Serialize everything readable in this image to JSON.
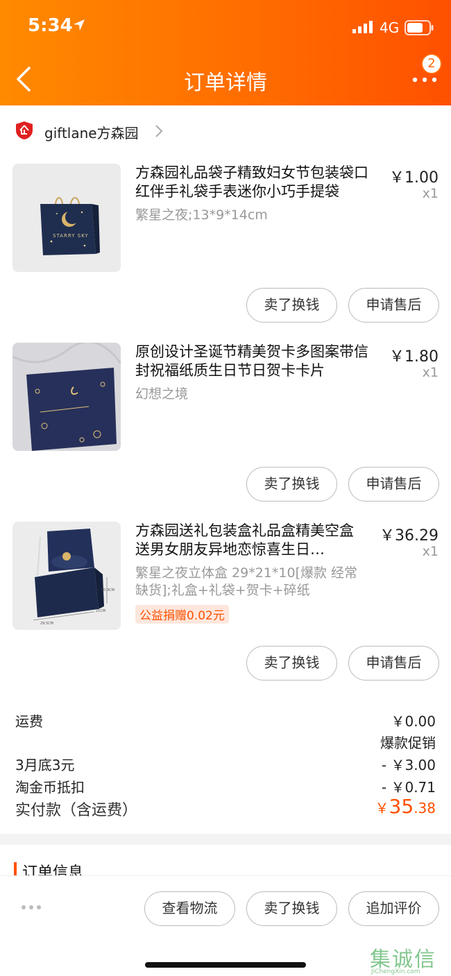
{
  "status_bar": {
    "time": "5:34",
    "network": "4G"
  },
  "header": {
    "title": "订单详情",
    "badge_count": "2"
  },
  "shop": {
    "name": "giftlane方森园"
  },
  "items": [
    {
      "title": "方森园礼品袋子精致妇女节包装袋口红伴手礼袋手表迷你小巧手提袋",
      "spec": "繁星之夜;13*9*14cm",
      "price": "￥1.00",
      "qty": "x1",
      "thumb_text": "STARRY SKY",
      "sell_label": "卖了换钱",
      "after_label": "申请售后"
    },
    {
      "title": "原创设计圣诞节精美贺卡多图案带信封祝福纸质生日节日贺卡卡片",
      "spec": "幻想之境",
      "price": "￥1.80",
      "qty": "x1",
      "sell_label": "卖了换钱",
      "after_label": "申请售后"
    },
    {
      "title": "方森园送礼包装盒礼品盒精美空盒送男女朋友异地恋惊喜生日…",
      "spec": "繁星之夜立体盒 29*21*10[爆款 经常缺货];礼盒+礼袋+贺卡+碎纸",
      "price": "￥36.29",
      "qty": "x1",
      "tag": "公益捐赠0.02元",
      "dim_w": "29.5CM",
      "dim_d": "21CM",
      "dim_h": "10.3CM",
      "sell_label": "卖了换钱",
      "after_label": "申请售后"
    }
  ],
  "fees": {
    "shipping_label": "运费",
    "shipping_value": "￥0.00",
    "promo_label": "爆款促销",
    "discount_label": "3月底3元",
    "discount_value": "- ￥3.00",
    "coin_label": "淘金币抵扣",
    "coin_value": "- ￥0.71",
    "total_label": "实付款（含运费）",
    "total_currency": "￥",
    "total_int": "35",
    "total_dec": ".38"
  },
  "section": {
    "title": "订单信息"
  },
  "bottom_bar": {
    "logistics_label": "查看物流",
    "sell_label": "卖了换钱",
    "review_label": "追加评价"
  },
  "watermark": {
    "text": "集诚信",
    "url": "JiChengXin.com"
  },
  "colors": {
    "accent": "#ff5000",
    "header_start": "#ff8a00",
    "header_end": "#ff5000"
  }
}
